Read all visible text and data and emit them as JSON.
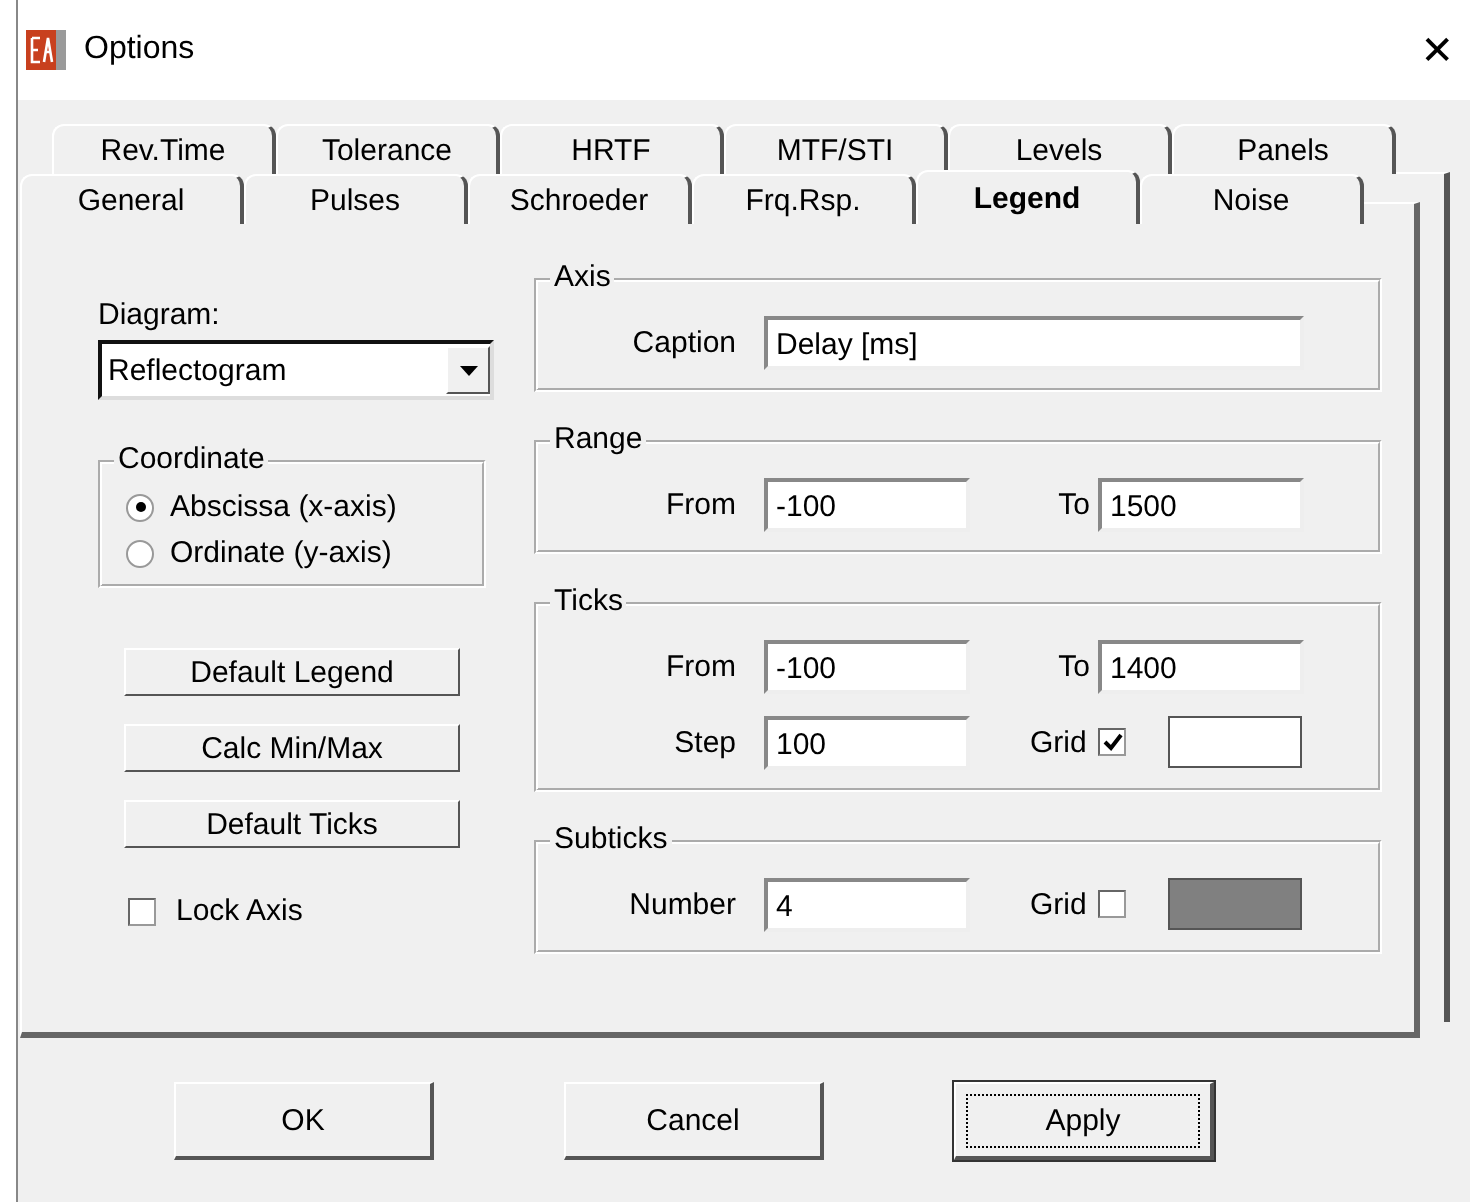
{
  "window": {
    "title": "Options",
    "close": "✕"
  },
  "tab_rows": [
    [
      {
        "label": "Rev.Time",
        "selected": false
      },
      {
        "label": "Tolerance",
        "selected": false
      },
      {
        "label": "HRTF",
        "selected": false
      },
      {
        "label": "MTF/STI",
        "selected": false
      },
      {
        "label": "Levels",
        "selected": false
      },
      {
        "label": "Panels",
        "selected": false
      }
    ],
    [
      {
        "label": "General",
        "selected": false
      },
      {
        "label": "Pulses",
        "selected": false
      },
      {
        "label": "Schroeder",
        "selected": false
      },
      {
        "label": "Frq.Rsp.",
        "selected": false
      },
      {
        "label": "Legend",
        "selected": true
      },
      {
        "label": "Noise",
        "selected": false
      }
    ]
  ],
  "diagram": {
    "label": "Diagram:",
    "value": "Reflectogram"
  },
  "coordinate": {
    "title": "Coordinate",
    "options": [
      {
        "label": "Abscissa (x-axis)",
        "selected": true
      },
      {
        "label": "Ordinate (y-axis)",
        "selected": false
      }
    ]
  },
  "actions": [
    "Default Legend",
    "Calc Min/Max",
    "Default Ticks"
  ],
  "lock_axis": {
    "label": "Lock Axis",
    "checked": false
  },
  "axis": {
    "title": "Axis",
    "caption_label": "Caption",
    "caption": "Delay [ms]"
  },
  "range": {
    "title": "Range",
    "from_label": "From",
    "from": "-100",
    "to_label": "To",
    "to": "1500"
  },
  "ticks": {
    "title": "Ticks",
    "from_label": "From",
    "from": "-100",
    "to_label": "To",
    "to": "1400",
    "step_label": "Step",
    "step": "100",
    "grid_label": "Grid",
    "grid": true,
    "color": "#ffffff"
  },
  "subticks": {
    "title": "Subticks",
    "number_label": "Number",
    "number": "4",
    "grid_label": "Grid",
    "grid": false,
    "color": "#808080"
  },
  "buttons": [
    {
      "label": "OK",
      "focused": false
    },
    {
      "label": "Cancel",
      "focused": false
    },
    {
      "label": "Apply",
      "focused": true
    }
  ]
}
